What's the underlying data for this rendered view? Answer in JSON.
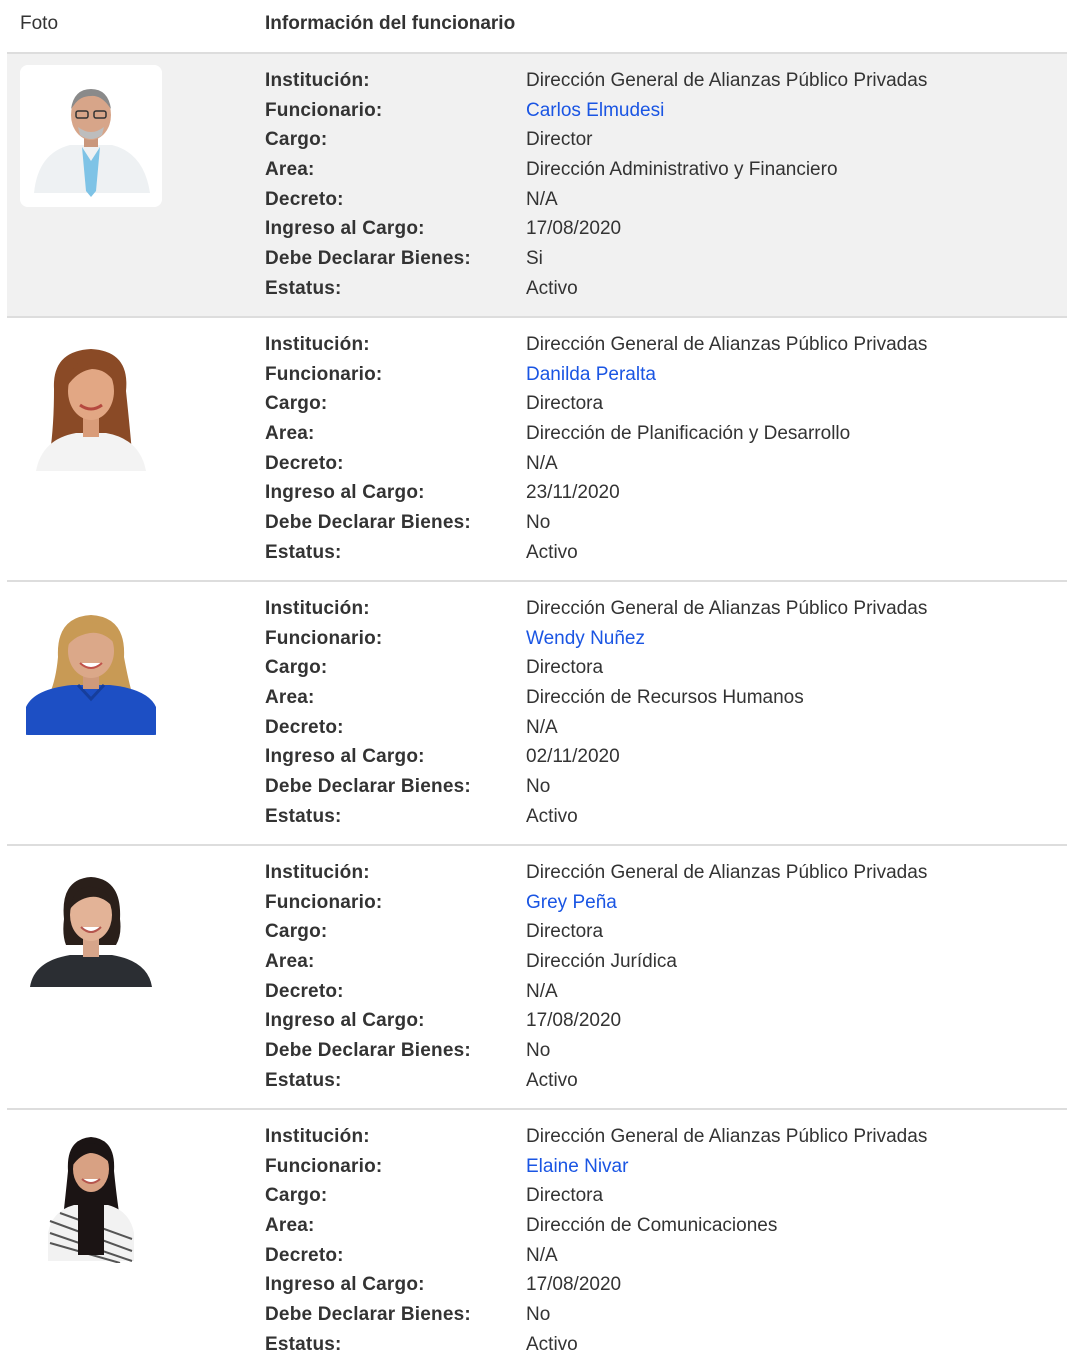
{
  "headers": {
    "photo": "Foto",
    "info": "Información del funcionario"
  },
  "labels": {
    "institucion": "Institución:",
    "funcionario": "Funcionario:",
    "cargo": "Cargo:",
    "area": "Area:",
    "decreto": "Decreto:",
    "ingreso": "Ingreso al Cargo:",
    "declarar": "Debe Declarar Bienes:",
    "estatus": "Estatus:"
  },
  "colors": {
    "link": "#1a55e3",
    "row_highlight": "#f1f1f1",
    "divider": "#dddddd"
  },
  "officials": [
    {
      "institucion": "Dirección General de Alianzas Público Privadas",
      "funcionario": "Carlos Elmudesi",
      "cargo": "Director",
      "area": "Dirección Administrativo y Financiero",
      "decreto": "N/A",
      "ingreso": "17/08/2020",
      "declarar": "Si",
      "estatus": "Activo",
      "photo": "man-portrait-photo"
    },
    {
      "institucion": "Dirección General de Alianzas Público Privadas",
      "funcionario": "Danilda Peralta",
      "cargo": "Directora",
      "area": "Dirección de Planificación y Desarrollo",
      "decreto": "N/A",
      "ingreso": "23/11/2020",
      "declarar": "No",
      "estatus": "Activo",
      "photo": "woman-portrait-photo"
    },
    {
      "institucion": "Dirección General de Alianzas Público Privadas",
      "funcionario": "Wendy Nuñez",
      "cargo": "Directora",
      "area": "Dirección de Recursos Humanos",
      "decreto": "N/A",
      "ingreso": "02/11/2020",
      "declarar": "No",
      "estatus": "Activo",
      "photo": "woman-portrait-photo"
    },
    {
      "institucion": "Dirección General de Alianzas Público Privadas",
      "funcionario": "Grey Peña",
      "cargo": "Directora",
      "area": "Dirección Jurídica",
      "decreto": "N/A",
      "ingreso": "17/08/2020",
      "declarar": "No",
      "estatus": "Activo",
      "photo": "woman-portrait-photo"
    },
    {
      "institucion": "Dirección General de Alianzas Público Privadas",
      "funcionario": "Elaine Nivar",
      "cargo": "Directora",
      "area": "Dirección de Comunicaciones",
      "decreto": "N/A",
      "ingreso": "17/08/2020",
      "declarar": "No",
      "estatus": "Activo",
      "photo": "woman-portrait-photo"
    }
  ]
}
